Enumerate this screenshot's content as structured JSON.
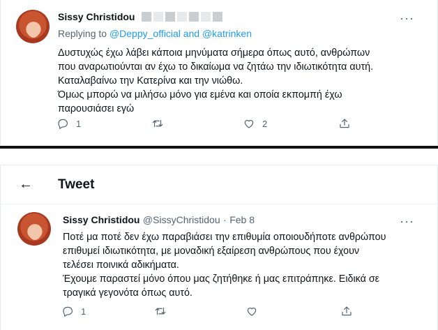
{
  "tweet1": {
    "author_name": "Sissy Christidou",
    "replying_prefix": "Replying to",
    "replying_to": "@Deppy_official and @katrinken",
    "more_glyph": "···",
    "lines": [
      "Δυστυχώς έχω λάβει κάποια μηνύματα σήμερα όπως αυτό, ανθρώπων",
      "που αναρωτιούνται αν έχω το δικαίωμα να ζητάω την ιδιωτικότητα αυτή.",
      "Καταλαβαίνω την Κατερίνα και την νιώθω.",
      "Όμως μπορώ να μιλήσω μόνο για εμένα και οποία εκπομπή έχω",
      "παρουσιάσει εγώ"
    ],
    "reply_count": "1",
    "like_count": "2"
  },
  "header": {
    "back_glyph": "←",
    "title": "Tweet"
  },
  "tweet2": {
    "author_name": "Sissy Christidou",
    "handle": "@SissyChristidou",
    "dot": "·",
    "date": "Feb 8",
    "more_glyph": "···",
    "lines": [
      "Ποτέ μα ποτέ δεν έχω παραβιάσει την επιθυμία οποιουδήποτε ανθρώπου",
      "επιθυμεί ιδιωτικότητα, με μοναδική εξαίρεση ανθρώπους που έχουν",
      "τελέσει ποινικά αδικήματα.",
      "Έχουμε παραστεί μόνο όπου μας ζητήθηκε ή μας επιτράπηκε. Ειδικά σε",
      "τραγικά γεγονότα όπως αυτό."
    ],
    "reply_count": "1"
  }
}
